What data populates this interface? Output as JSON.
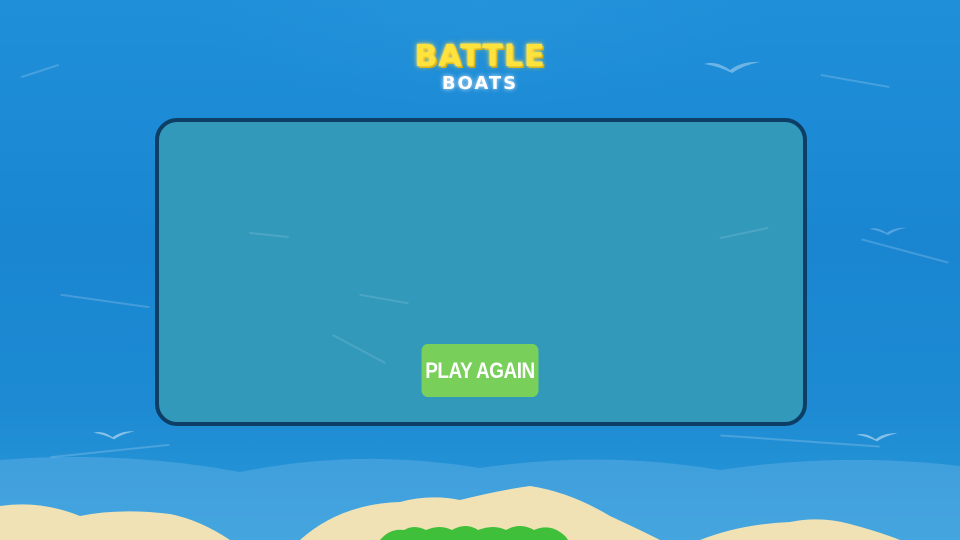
{
  "game": {
    "logo": {
      "line1": "BATTLE",
      "line2": "BOATS"
    },
    "game_over_panel": {
      "play_again_label": "PLAY AGAIN"
    }
  },
  "colors": {
    "sea": "#1c8bd6",
    "panel_fill": "#3399bb",
    "panel_border": "#0c3e66",
    "button": "#78d05a",
    "logo_yellow": "#ffe23c",
    "sand": "#f1e2b6",
    "grass": "#3fbf3a"
  },
  "icons": {
    "background": [
      "seagull-icon",
      "wave-streak",
      "sand-dune",
      "grass-tuft"
    ]
  }
}
